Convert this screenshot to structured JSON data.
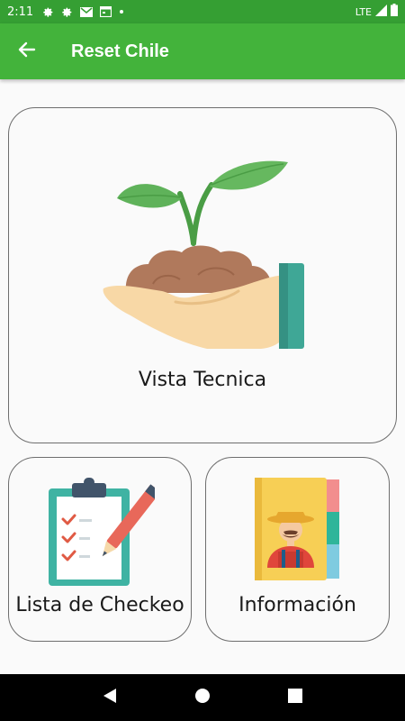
{
  "status_bar": {
    "time": "2:11",
    "network": "LTE",
    "icons": [
      "gear-icon",
      "gear-icon",
      "gmail-icon",
      "calendar-icon",
      "dot-icon",
      "signal-icon",
      "battery-icon"
    ]
  },
  "app_bar": {
    "title": "Reset Chile",
    "back_icon": "arrow-left-icon",
    "background_color": "#43b33b",
    "status_color": "#359f33"
  },
  "cards": {
    "main": {
      "label": "Vista Tecnica",
      "icon": "plant-in-hand-icon"
    },
    "left": {
      "label": "Lista de Checkeo",
      "icon": "clipboard-checklist-icon"
    },
    "right": {
      "label": "Información",
      "icon": "farmer-notebook-icon"
    }
  },
  "nav_bar": {
    "buttons": [
      "back-triangle-icon",
      "home-circle-icon",
      "recents-square-icon"
    ]
  }
}
